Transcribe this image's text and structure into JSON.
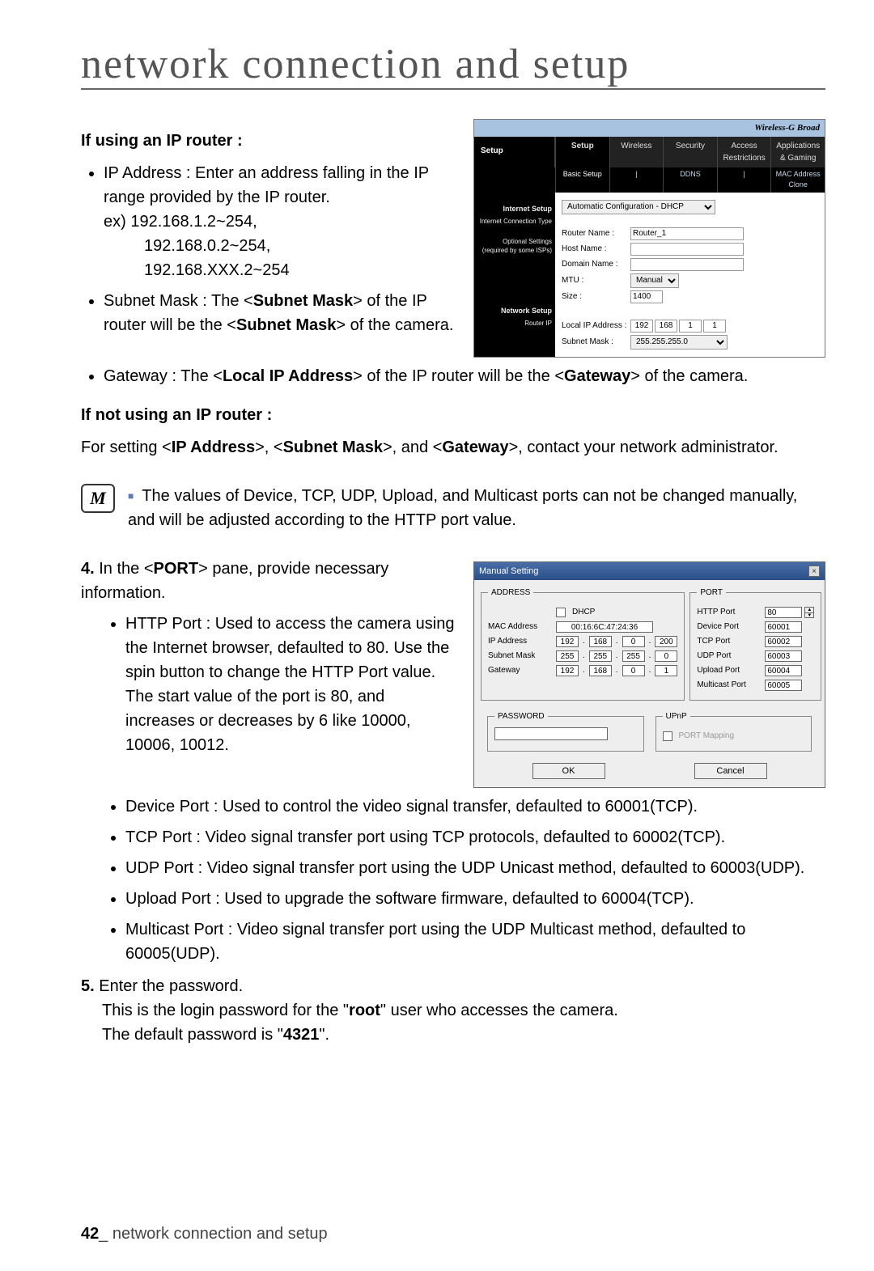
{
  "page_title": "network connection and setup",
  "section_if_router": "If using an IP router :",
  "bullets_router": {
    "ip_main": "IP Address : Enter an address falling in the IP range provided by the IP router.",
    "ex_label": "ex)",
    "ex_lines": [
      "192.168.1.2~254,",
      "192.168.0.2~254,",
      "192.168.XXX.2~254"
    ],
    "subnet_html_parts": [
      "Subnet Mask : The <",
      "Subnet Mask",
      "> of the IP router will be the <",
      "Subnet Mask",
      "> of the camera."
    ],
    "gateway_parts": [
      "Gateway : The <",
      "Local IP Address",
      "> of the IP router will be the <",
      "Gateway",
      "> of the camera."
    ]
  },
  "section_no_router": "If not using an IP router :",
  "no_router_text_parts": [
    "For setting <",
    "IP Address",
    ">, <",
    "Subnet Mask",
    ">, and <",
    "Gateway",
    ">, contact your network administrator."
  ],
  "note_icon": "M",
  "note_text": "The values of Device, TCP, UDP, Upload, and Multicast ports can not be changed manually, and will be adjusted according to the HTTP port value.",
  "step4": {
    "num": "4.",
    "lead_parts": [
      "In the <",
      "PORT",
      "> pane, provide necessary information."
    ],
    "items": [
      "HTTP Port : Used to access the camera using the Internet browser, defaulted to 80. Use the spin button to change the HTTP Port value. The start value of the port is 80, and increases or decreases by 6 like 10000, 10006, 10012.",
      "Device Port : Used to control the video signal transfer, defaulted to 60001(TCP).",
      "TCP Port : Video signal transfer port using TCP protocols, defaulted to 60002(TCP).",
      "UDP Port : Video signal transfer port using the UDP Unicast method, defaulted to 60003(UDP).",
      "Upload Port : Used to upgrade the software firmware, defaulted to 60004(TCP).",
      "Multicast Port : Video signal transfer port using the UDP Multicast method, defaulted to 60005(UDP)."
    ]
  },
  "step5": {
    "num": "5.",
    "lead": "Enter the password.",
    "l2_parts": [
      "This is the login password for the \"",
      "root",
      "\" user who accesses the camera."
    ],
    "l3_parts": [
      "The default password is \"",
      "4321",
      "\"."
    ]
  },
  "footer": {
    "page_num": "42",
    "sep": "_",
    "label": " network connection and setup"
  },
  "router_ui": {
    "brand": "Wireless-G Broad",
    "setup_label": "Setup",
    "tabs": [
      "Setup",
      "Wireless",
      "Security",
      "Access Restrictions",
      "Applications & Gaming"
    ],
    "subnav": [
      "Basic Setup",
      "",
      "DDNS",
      "",
      "MAC Address Clone"
    ],
    "side": {
      "internet_setup": "Internet Setup",
      "ict": "Internet Connection Type",
      "opt1": "Optional Settings",
      "opt2": "(required by some ISPs)",
      "net": "Network Setup",
      "rip": "Router IP"
    },
    "auto_label": "Automatic Configuration - DHCP",
    "labels": {
      "router_name": "Router Name :",
      "host_name": "Host Name :",
      "domain_name": "Domain Name :",
      "mtu": "MTU :",
      "size": "Size :",
      "local_ip": "Local IP Address :",
      "subnet_mask": "Subnet Mask :"
    },
    "values": {
      "router_name": "Router_1",
      "mtu_mode": "Manual",
      "size": "1400",
      "ip": [
        "192",
        "168",
        "1",
        "1"
      ],
      "mask": "255.255.255.0"
    }
  },
  "manual_ui": {
    "title": "Manual Setting",
    "address_legend": "ADDRESS",
    "dhcp_label": "DHCP",
    "mac_label": "MAC Address",
    "mac_value": "00:16:6C:47:24:36",
    "ip_label": "IP Address",
    "ip": [
      "192",
      "168",
      "0",
      "200"
    ],
    "subnet_label": "Subnet Mask",
    "subnet": [
      "255",
      "255",
      "255",
      "0"
    ],
    "gateway_label": "Gateway",
    "gateway": [
      "192",
      "168",
      "0",
      "1"
    ],
    "port_legend": "PORT",
    "ports": {
      "http": {
        "label": "HTTP Port",
        "value": "80"
      },
      "device": {
        "label": "Device Port",
        "value": "60001"
      },
      "tcp": {
        "label": "TCP Port",
        "value": "60002"
      },
      "udp": {
        "label": "UDP Port",
        "value": "60003"
      },
      "upload": {
        "label": "Upload Port",
        "value": "60004"
      },
      "multicast": {
        "label": "Multicast Port",
        "value": "60005"
      }
    },
    "password_legend": "PASSWORD",
    "upnp_legend": "UPnP",
    "port_mapping_label": "PORT Mapping",
    "ok": "OK",
    "cancel": "Cancel"
  }
}
